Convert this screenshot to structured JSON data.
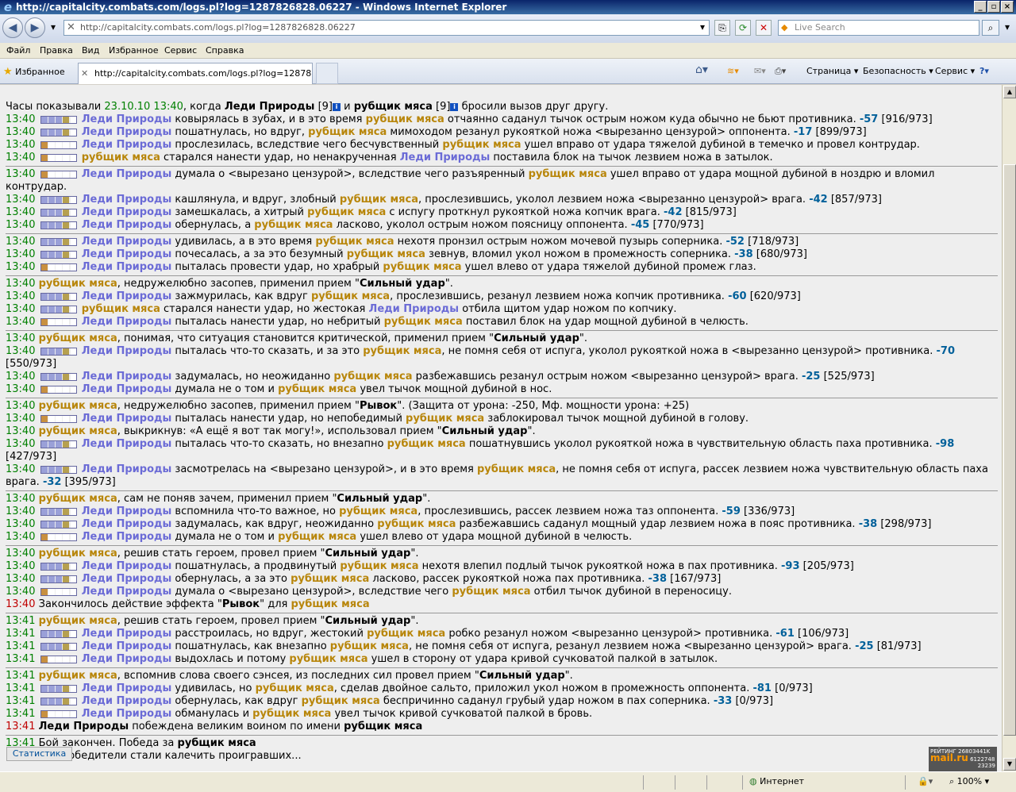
{
  "window": {
    "title": "http://capitalcity.combats.com/logs.pl?log=1287826828.06227 - Windows Internet Explorer"
  },
  "address": {
    "url": "http://capitalcity.combats.com/logs.pl?log=1287826828.06227",
    "search_placeholder": "Live Search"
  },
  "menu": [
    "Файл",
    "Правка",
    "Вид",
    "Избранное",
    "Сервис",
    "Справка"
  ],
  "favorites_label": "Избранное",
  "tab_title": "http://capitalcity.combats.com/logs.pl?log=12878268...",
  "commands": {
    "page": "Страница",
    "security": "Безопасность",
    "service": "Сервис"
  },
  "log": {
    "intro": {
      "pre": "Часы показывали",
      "date": "23.10.10 13:40",
      "mid": ", когда",
      "p1": "Леди Природы",
      "lvl1": "[9]",
      "and": "и",
      "p2": "рубщик мяса",
      "lvl2": "[9]",
      "post": "бросили вызов друг другу."
    },
    "lines": [
      "13:40|A|Леди Природы ковырялась в зубах, и в это время рубщик мяса отчаянно саданул тычок острым ножом куда обычно не бьют противника. -57 [916/973]",
      "13:40|A|Леди Природы пошатнулась, но вдруг, рубщик мяса мимоходом резанул рукояткой ножа <вырезанно цензурой> оппонента. -17 [899/973]",
      "13:40|B|Леди Природы прослезилась, вследствие чего бесчувственный рубщик мяса ушел вправо от удара тяжелой дубиной в темечко и провел контрудар.",
      "13:40|B|рубщик мяса старался нанести удар, но ненакрученная Леди Природы поставила блок на тычок лезвием ножа в затылок.",
      "---",
      "13:40|B|Леди Природы думала о <вырезано цензурой>, вследствие чего разъяренный рубщик мяса ушел вправо от удара мощной дубиной в ноздрю и вломил контрудар.",
      "13:40|A|Леди Природы кашлянула, и вдруг, злобный рубщик мяса, прослезившись, уколол лезвием ножа <вырезанно цензурой> врага. -42 [857/973]",
      "13:40|A|Леди Природы замешкалась, а хитрый рубщик мяса с испугу проткнул рукояткой ножа копчик врага. -42 [815/973]",
      "13:40|A|Леди Природы обернулась, а рубщик мяса ласково, уколол острым ножом поясницу оппонента. -45 [770/973]",
      "---",
      "13:40|A|Леди Природы удивилась, а в это время рубщик мяса нехотя пронзил острым ножом мочевой пузырь соперника. -52 [718/973]",
      "13:40|A|Леди Природы почесалась, а за это безумный рубщик мяса зевнув, вломил укол ножом в промежность соперника. -38 [680/973]",
      "13:40|B|Леди Природы пыталась провести удар, но храбрый рубщик мяса ушел влево от удара тяжелой дубиной промеж глаз.",
      "---",
      "13:40||рубщик мяса, недружелюбно засопев, применил прием \"Сильный удар\".",
      "13:40|A|Леди Природы зажмурилась, как вдруг рубщик мяса, прослезившись, резанул лезвием ножа копчик противника. -60 [620/973]",
      "13:40|A|рубщик мяса старался нанести удар, но жестокая Леди Природы отбила щитом удар ножом по копчику.",
      "13:40|B|Леди Природы пыталась нанести удар, но небритый рубщик мяса поставил блок на удар мощной дубиной в челюсть.",
      "---",
      "13:40||рубщик мяса, понимая, что ситуация становится критической, применил прием \"Сильный удар\".",
      "13:40|A|Леди Природы пыталась что-то сказать, и за это рубщик мяса, не помня себя от испуга, уколол рукояткой ножа в <вырезанно цензурой> противника. -70 [550/973]",
      "13:40|A|Леди Природы задумалась, но неожиданно рубщик мяса разбежавшись резанул острым ножом <вырезанно цензурой> врага. -25 [525/973]",
      "13:40|B|Леди Природы думала не о том и рубщик мяса увел тычок мощной дубиной в нос.",
      "---",
      "13:40||рубщик мяса, недружелюбно засопев, применил прием \"Рывок\". (Защита от урона: -250, Мф. мощности урона: +25)",
      "13:40|B|Леди Природы пыталась нанести удар, но непобедимый рубщик мяса заблокировал тычок мощной дубиной в голову.",
      "13:40||рубщик мяса, выкрикнув: «А ещё я вот так могу!», использовал прием \"Сильный удар\".",
      "13:40|A|Леди Природы пыталась что-то сказать, но внезапно рубщик мяса пошатнувшись уколол рукояткой ножа в чувствительную область паха противника. -98 [427/973]",
      "13:40|A|Леди Природы засмотрелась на <вырезано цензурой>, и в это время рубщик мяса, не помня себя от испуга, рассек лезвием ножа чувствительную область паха врага. -32 [395/973]",
      "---",
      "13:40||рубщик мяса, сам не поняв зачем, применил прием \"Сильный удар\".",
      "13:40|A|Леди Природы вспомнила что-то важное, но рубщик мяса, прослезившись, рассек лезвием ножа таз оппонента. -59 [336/973]",
      "13:40|A|Леди Природы задумалась, как вдруг, неожиданно рубщик мяса разбежавшись саданул мощный удар лезвием ножа в пояс противника. -38 [298/973]",
      "13:40|B|Леди Природы думала не о том и рубщик мяса ушел влево от удара мощной дубиной в челюсть.",
      "---",
      "13:40||рубщик мяса, решив стать героем, провел прием \"Сильный удар\".",
      "13:40|A|Леди Природы пошатнулась, а продвинутый рубщик мяса нехотя влепил подлый тычок рукояткой ножа в пах противника. -93 [205/973]",
      "13:40|A|Леди Природы обернулась, а за это рубщик мяса ласково, рассек рукояткой ножа пах противника. -38 [167/973]",
      "13:40|B|Леди Природы думала о <вырезано цензурой>, вследствие чего рубщик мяса отбил тычок дубиной в переносицу.",
      "13:40|R|Закончилось действие эффекта \"Рывок\" для рубщик мяса",
      "---",
      "13:41||рубщик мяса, решив стать героем, провел прием \"Сильный удар\".",
      "13:41|A|Леди Природы расстроилась, но вдруг, жестокий рубщик мяса робко резанул ножом <вырезанно цензурой> противника. -61 [106/973]",
      "13:41|A|Леди Природы пошатнулась, как внезапно рубщик мяса, не помня себя от испуга, резанул лезвием ножа <вырезанно цензурой> врага. -25 [81/973]",
      "13:41|B|Леди Природы выдохлась и потому рубщик мяса ушел в сторону от удара кривой сучковатой палкой в затылок.",
      "---",
      "13:41||рубщик мяса, вспомнив слова своего сэнсея, из последних сил провел прием \"Сильный удар\".",
      "13:41|A|Леди Природы удивилась, но рубщик мяса, сделав двойное сальто, приложил укол ножом в промежность оппонента. -81 [0/973]",
      "13:41|A|Леди Природы обернулась, как вдруг рубщик мяса беспричинно саданул грубый удар ножом в пах соперника. -33 [0/973]",
      "13:41|B|Леди Природы обманулась и рубщик мяса увел тычок кривой сучковатой палкой в бровь.",
      "13:41|D|Леди Природы побеждена великим воином по имени рубщик мяса",
      "---",
      "13:41|E|Бой закончен. Победа за рубщик мяса",
      "13:41|E|... и победители стали калечить проигравших..."
    ],
    "player1": "Леди Природы",
    "player2": "рубщик мяса"
  },
  "buttons": {
    "stats": "Статистика"
  },
  "counter": {
    "label": "РЕЙТИНГ 26803441K",
    "v1": "6122748",
    "v2": "23239",
    "brand": "mail.ru"
  },
  "status": {
    "zone": "Интернет",
    "zoom": "100%"
  },
  "colors": {
    "player1": "#6b6bd6",
    "player2": "#b8860b",
    "damage": "#00609a",
    "time": "#008000",
    "time_alert": "#c00000"
  }
}
